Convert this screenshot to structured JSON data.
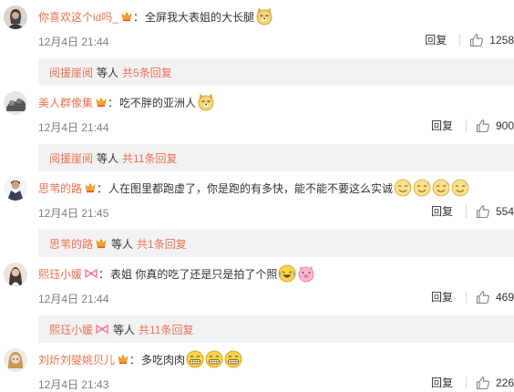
{
  "colors": {
    "username": "#eb7350",
    "text": "#333333",
    "time": "#808080",
    "reply_bg": "#f2f2f5"
  },
  "comments": [
    {
      "username": "你喜欢这个id吗_",
      "badge": "vip-crown-icon",
      "separator": "：",
      "text": "全屏我大表姐的大长腿",
      "emojis": [
        "doge-emoji"
      ],
      "time": "12月4日 21:44",
      "reply_label": "回复",
      "likes": "1258",
      "replies": {
        "user": "阅援崖阅",
        "etc": "等人",
        "more": "共5条回复"
      }
    },
    {
      "username": "美人群像集",
      "badge": "vip-crown-icon",
      "separator": "：",
      "text": "吃不胖的亚洲人",
      "emojis": [
        "doge-emoji"
      ],
      "time": "12月4日 21:44",
      "reply_label": "回复",
      "likes": "900",
      "replies": {
        "user": "阅援崖阅",
        "etc": "等人",
        "more": "共11条回复"
      }
    },
    {
      "username": "思苇的路",
      "badge": "vip-crown-icon",
      "separator": "：",
      "text": "人在图里都跑虚了，你是跑的有多快，能不能不要这么实诚",
      "emojis": [
        "sweat-smile-emoji",
        "sweat-smile-emoji",
        "sweat-smile-emoji",
        "sweat-smile-emoji"
      ],
      "time": "12月4日 21:45",
      "reply_label": "回复",
      "likes": "554",
      "replies": {
        "user": "思苇的路",
        "etc": "等人",
        "more": "共1条回复"
      }
    },
    {
      "username": "熙珏小媛",
      "badge": "bow-icon",
      "separator": "：",
      "text": "表姐 你真的吃了还是只是拍了个照",
      "emojis": [
        "laugh-cry-emoji",
        "pig-emoji"
      ],
      "time": "12月4日 21:44",
      "reply_label": "回复",
      "likes": "469",
      "replies": {
        "user": "熙珏小媛",
        "etc": "等人",
        "more": "共11条回复"
      }
    },
    {
      "username": "刘炘刘燮姚贝儿",
      "badge": "vip-crown-icon",
      "separator": "：",
      "text": "多吃肉肉",
      "emojis": [
        "grin-emoji",
        "grin-emoji",
        "grin-emoji"
      ],
      "time": "12月4日 21:43",
      "reply_label": "回复",
      "likes": "226"
    }
  ]
}
